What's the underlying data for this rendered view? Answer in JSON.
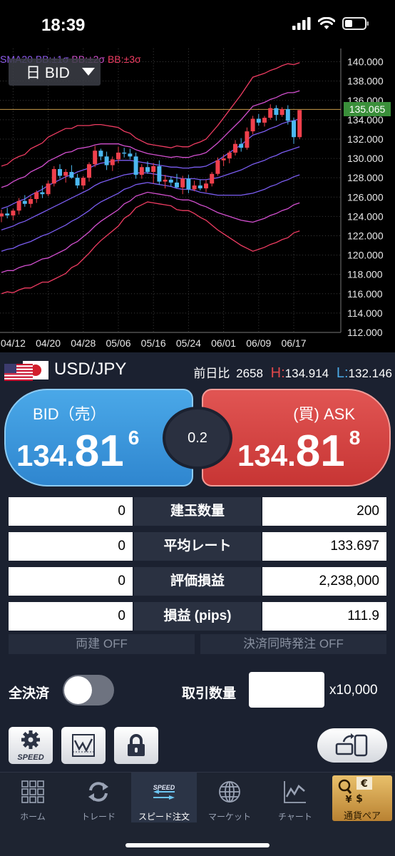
{
  "status": {
    "time": "18:39",
    "icons": [
      "signal-icon",
      "wifi-icon",
      "battery-icon"
    ]
  },
  "chart": {
    "timeframe": "日 BID",
    "legend": [
      {
        "text": "SMA20",
        "color": "#8f5cf0"
      },
      {
        "text": "BB:±1σ",
        "color": "#8f5cf0"
      },
      {
        "text": "BB:±2σ",
        "color": "#d24fcf"
      },
      {
        "text": "BB:±3σ",
        "color": "#ef3c62"
      }
    ],
    "current_price_label": "135.065"
  },
  "chart_data": {
    "type": "candlestick",
    "title": "",
    "y_ticks": [
      "140.000",
      "138.000",
      "136.000",
      "134.000",
      "132.000",
      "130.000",
      "128.000",
      "126.000",
      "124.000",
      "122.000",
      "120.000",
      "118.000",
      "116.000",
      "114.000",
      "112.000"
    ],
    "ylim": [
      112.0,
      141.0
    ],
    "x_ticks": [
      {
        "label": "04/12",
        "index": 2
      },
      {
        "label": "04/20",
        "index": 8
      },
      {
        "label": "04/28",
        "index": 14
      },
      {
        "label": "05/06",
        "index": 20
      },
      {
        "label": "05/16",
        "index": 26
      },
      {
        "label": "05/24",
        "index": 32
      },
      {
        "label": "06/01",
        "index": 38
      },
      {
        "label": "06/09",
        "index": 44
      },
      {
        "label": "06/17",
        "index": 50
      }
    ],
    "current_price": 135.065,
    "candles": [
      {
        "o": 124.0,
        "h": 124.7,
        "l": 123.4,
        "c": 124.3
      },
      {
        "o": 124.3,
        "h": 124.9,
        "l": 123.8,
        "c": 124.1
      },
      {
        "o": 124.1,
        "h": 124.8,
        "l": 123.6,
        "c": 124.6
      },
      {
        "o": 124.6,
        "h": 125.9,
        "l": 124.2,
        "c": 125.6
      },
      {
        "o": 125.6,
        "h": 126.2,
        "l": 125.0,
        "c": 125.3
      },
      {
        "o": 125.3,
        "h": 126.1,
        "l": 124.9,
        "c": 125.8
      },
      {
        "o": 125.8,
        "h": 126.7,
        "l": 125.4,
        "c": 126.5
      },
      {
        "o": 126.5,
        "h": 127.2,
        "l": 125.9,
        "c": 126.3
      },
      {
        "o": 126.3,
        "h": 127.7,
        "l": 126.1,
        "c": 127.4
      },
      {
        "o": 127.4,
        "h": 129.2,
        "l": 127.1,
        "c": 128.9
      },
      {
        "o": 128.9,
        "h": 129.4,
        "l": 127.9,
        "c": 128.2
      },
      {
        "o": 128.2,
        "h": 128.9,
        "l": 127.5,
        "c": 128.6
      },
      {
        "o": 128.6,
        "h": 129.3,
        "l": 127.9,
        "c": 128.0
      },
      {
        "o": 128.0,
        "h": 128.4,
        "l": 126.9,
        "c": 127.2
      },
      {
        "o": 127.2,
        "h": 128.2,
        "l": 126.8,
        "c": 128.0
      },
      {
        "o": 128.0,
        "h": 129.6,
        "l": 127.6,
        "c": 129.4
      },
      {
        "o": 129.4,
        "h": 131.3,
        "l": 129.1,
        "c": 130.8
      },
      {
        "o": 130.8,
        "h": 131.0,
        "l": 129.8,
        "c": 130.2
      },
      {
        "o": 130.2,
        "h": 130.7,
        "l": 128.8,
        "c": 129.3
      },
      {
        "o": 129.3,
        "h": 130.2,
        "l": 128.7,
        "c": 129.9
      },
      {
        "o": 129.9,
        "h": 131.2,
        "l": 129.5,
        "c": 130.6
      },
      {
        "o": 130.6,
        "h": 131.1,
        "l": 130.1,
        "c": 130.5
      },
      {
        "o": 130.5,
        "h": 131.0,
        "l": 129.9,
        "c": 130.2
      },
      {
        "o": 130.2,
        "h": 130.6,
        "l": 127.9,
        "c": 128.3
      },
      {
        "o": 128.3,
        "h": 129.4,
        "l": 127.9,
        "c": 129.1
      },
      {
        "o": 129.1,
        "h": 129.7,
        "l": 128.4,
        "c": 128.6
      },
      {
        "o": 128.6,
        "h": 129.5,
        "l": 127.4,
        "c": 129.2
      },
      {
        "o": 129.2,
        "h": 129.8,
        "l": 127.3,
        "c": 127.6
      },
      {
        "o": 127.6,
        "h": 128.3,
        "l": 126.9,
        "c": 127.8
      },
      {
        "o": 127.8,
        "h": 128.1,
        "l": 127.1,
        "c": 127.5
      },
      {
        "o": 127.5,
        "h": 128.4,
        "l": 126.9,
        "c": 127.0
      },
      {
        "o": 127.0,
        "h": 128.2,
        "l": 126.3,
        "c": 127.9
      },
      {
        "o": 127.9,
        "h": 128.3,
        "l": 126.4,
        "c": 126.8
      },
      {
        "o": 126.8,
        "h": 127.7,
        "l": 126.6,
        "c": 127.2
      },
      {
        "o": 127.2,
        "h": 127.8,
        "l": 126.7,
        "c": 126.9
      },
      {
        "o": 126.9,
        "h": 127.8,
        "l": 126.5,
        "c": 127.4
      },
      {
        "o": 127.4,
        "h": 128.6,
        "l": 127.1,
        "c": 128.4
      },
      {
        "o": 128.4,
        "h": 130.1,
        "l": 128.2,
        "c": 129.8
      },
      {
        "o": 129.8,
        "h": 130.4,
        "l": 129.2,
        "c": 130.0
      },
      {
        "o": 130.0,
        "h": 130.8,
        "l": 129.5,
        "c": 130.6
      },
      {
        "o": 130.6,
        "h": 131.9,
        "l": 130.3,
        "c": 131.5
      },
      {
        "o": 131.5,
        "h": 132.1,
        "l": 130.7,
        "c": 131.1
      },
      {
        "o": 131.1,
        "h": 133.2,
        "l": 130.9,
        "c": 132.8
      },
      {
        "o": 132.8,
        "h": 134.4,
        "l": 132.5,
        "c": 134.1
      },
      {
        "o": 134.1,
        "h": 134.6,
        "l": 133.4,
        "c": 133.7
      },
      {
        "o": 133.7,
        "h": 134.4,
        "l": 133.3,
        "c": 134.2
      },
      {
        "o": 134.2,
        "h": 135.6,
        "l": 134.0,
        "c": 135.2
      },
      {
        "o": 135.2,
        "h": 135.5,
        "l": 133.9,
        "c": 134.5
      },
      {
        "o": 134.5,
        "h": 135.3,
        "l": 134.3,
        "c": 135.1
      },
      {
        "o": 135.1,
        "h": 135.5,
        "l": 133.5,
        "c": 133.9
      },
      {
        "o": 133.9,
        "h": 134.2,
        "l": 131.5,
        "c": 132.2
      },
      {
        "o": 132.2,
        "h": 135.0,
        "l": 132.0,
        "c": 135.0
      }
    ],
    "sma20": [
      122.6,
      122.8,
      123.0,
      123.3,
      123.5,
      123.8,
      124.1,
      124.4,
      124.7,
      125.0,
      125.3,
      125.6,
      125.9,
      126.2,
      126.5,
      126.8,
      127.2,
      127.5,
      127.7,
      127.9,
      128.1,
      128.3,
      128.4,
      128.5,
      128.5,
      128.5,
      128.4,
      128.3,
      128.2,
      128.1,
      128.0,
      127.9,
      127.9,
      127.9,
      127.8,
      127.8,
      127.9,
      128.0,
      128.2,
      128.4,
      128.6,
      128.8,
      129.1,
      129.4,
      129.6,
      129.8,
      130.1,
      130.3,
      130.6,
      130.8,
      131.0,
      131.2
    ],
    "sigma": [
      2.2,
      2.2,
      2.3,
      2.3,
      2.3,
      2.4,
      2.4,
      2.4,
      2.5,
      2.5,
      2.5,
      2.5,
      2.4,
      2.4,
      2.3,
      2.2,
      2.1,
      2.0,
      1.9,
      1.8,
      1.7,
      1.5,
      1.4,
      1.2,
      1.1,
      1.0,
      1.0,
      1.0,
      1.0,
      1.0,
      1.1,
      1.1,
      1.1,
      1.2,
      1.3,
      1.4,
      1.6,
      1.8,
      2.0,
      2.2,
      2.4,
      2.6,
      2.8,
      3.0,
      3.0,
      3.0,
      3.0,
      3.0,
      3.0,
      3.0,
      2.9,
      2.9
    ]
  },
  "pair": {
    "flag_icon": "us-jp-flag-icon",
    "name": "USD/JPY",
    "change_label": "前日比",
    "change_value": "2658",
    "high_label": "H:",
    "high_value": "134.914",
    "low_label": "L:",
    "low_value": "132.146"
  },
  "bid": {
    "label": "BID（売）",
    "main": "134.",
    "big": "81",
    "small": "6"
  },
  "ask": {
    "label": "(買) ASK",
    "main": "134.",
    "big": "81",
    "small": "8"
  },
  "spread": "0.2",
  "positions": [
    {
      "sell": "0",
      "label": "建玉数量",
      "buy": "200"
    },
    {
      "sell": "0",
      "label": "平均レート",
      "buy": "133.697"
    },
    {
      "sell": "0",
      "label": "評価損益",
      "buy": "2,238,000"
    },
    {
      "sell": "0",
      "label": "損益 (pips)",
      "buy": "111.9"
    }
  ],
  "options": {
    "hedge": "両建 OFF",
    "settle_order": "決済同時発注 OFF"
  },
  "close_all": {
    "label": "全決済",
    "on": false
  },
  "quantity": {
    "label": "取引数量",
    "value": "",
    "unit": "x10,000"
  },
  "toolbar": {
    "speed_label": "SPEED",
    "chart_icon": "chart-line-icon",
    "lock_icon": "lock-icon",
    "rotate_icon": "rotate-screen-icon"
  },
  "tabs": [
    {
      "label": "ホーム",
      "icon": "grid-icon",
      "active": false
    },
    {
      "label": "トレード",
      "icon": "refresh-arrows-icon",
      "active": false
    },
    {
      "label": "スピード注文",
      "icon": "speed-arrows-icon",
      "active": true
    },
    {
      "label": "マーケット",
      "icon": "globe-icon",
      "active": false
    },
    {
      "label": "チャート",
      "icon": "chart-icon",
      "active": false
    },
    {
      "label": "通貨ペア",
      "icon": "currency-icon",
      "active": false
    }
  ]
}
